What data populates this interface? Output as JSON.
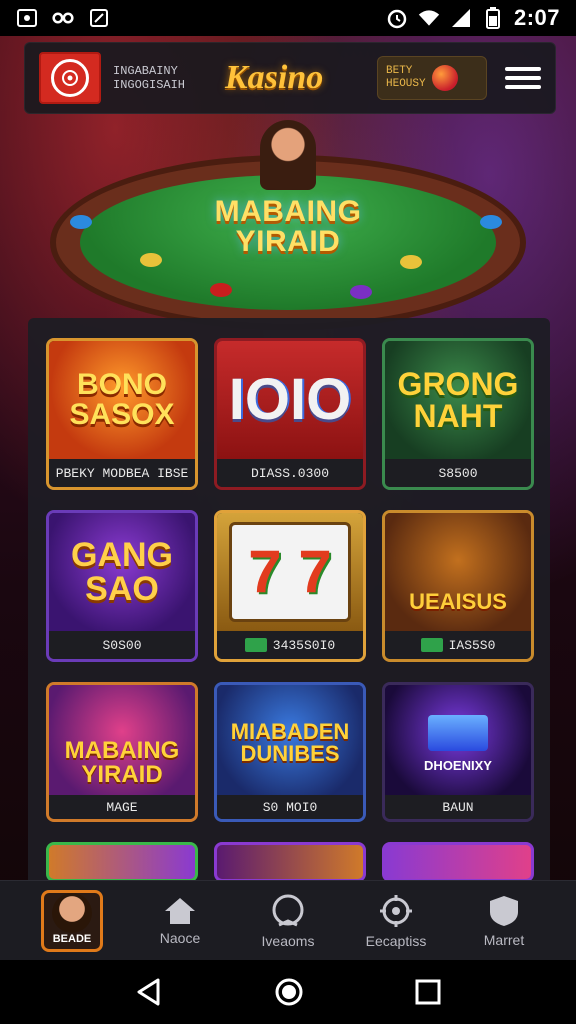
{
  "status_bar": {
    "time": "2:07",
    "left_icons": [
      "photo-icon",
      "link-icon",
      "edit-icon"
    ],
    "right_icons": [
      "alarm-icon",
      "wifi-icon",
      "signal-icon",
      "battery-icon"
    ]
  },
  "header": {
    "small_text": "INGABAINY\nINGOGISAIH",
    "brand": "Kasino",
    "promo_text": "BETY\nHEOUSY",
    "menu_icon": "hamburger-icon"
  },
  "hero": {
    "title_line1": "MABAING",
    "title_line2": "YIRAID"
  },
  "games": [
    {
      "title": "BONO\nSASOX",
      "caption": "PBEKY  MODBEA  IBSE",
      "theme": "orange"
    },
    {
      "title": "IOIO",
      "caption": "DIASS.0300",
      "theme": "red"
    },
    {
      "title": "GRONG\nNAHT",
      "caption": "S8500",
      "theme": "green"
    },
    {
      "title": "GANG\nSAO",
      "caption": "S0S00",
      "theme": "purple"
    },
    {
      "title": "7 7",
      "caption": "3435S0I0",
      "theme": "slots"
    },
    {
      "title": "UEAISUS",
      "caption": "IAS5S0",
      "theme": "dog"
    },
    {
      "title": "MABAING\nYIRAID",
      "caption": "MAGE",
      "theme": "lady"
    },
    {
      "title": "MIABADEN\nDUNIBES",
      "caption": "S0 MOI0",
      "theme": "blue"
    },
    {
      "title": "DHOENIXY",
      "caption": "BAUN",
      "theme": "gem"
    }
  ],
  "bottom_nav": [
    {
      "label": "BEADE",
      "icon": "avatar-icon",
      "active": true
    },
    {
      "label": "Naoce",
      "icon": "home-icon",
      "active": false
    },
    {
      "label": "Iveaoms",
      "icon": "search-icon",
      "active": false
    },
    {
      "label": "Eecaptiss",
      "icon": "gear-icon",
      "active": false
    },
    {
      "label": "Marret",
      "icon": "shield-icon",
      "active": false
    }
  ],
  "system_nav": [
    "back-icon",
    "home-circle-icon",
    "recents-icon"
  ],
  "colors": {
    "accent": "#ffc23a",
    "tile_border": "#c98b2c",
    "nav_active": "#e07a1a"
  }
}
